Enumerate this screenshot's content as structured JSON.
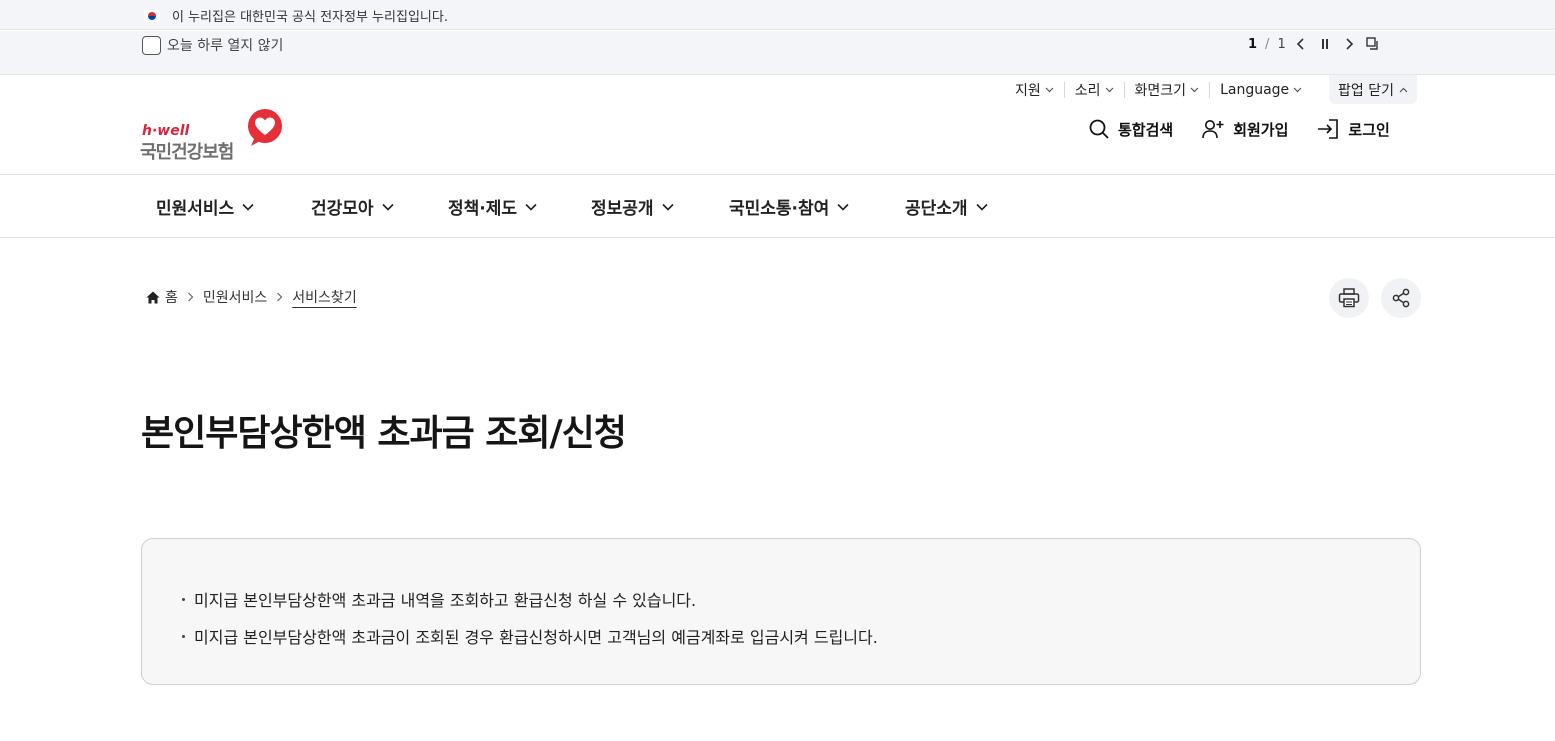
{
  "gov_banner": {
    "text": "이 누리집은 대한민국 공식 전자정부 누리집입니다."
  },
  "popup_zone": {
    "dismiss_label": "오늘 하루 열지 않기",
    "page_current": "1",
    "page_separator": "/",
    "page_total": "1"
  },
  "utility": {
    "items": [
      "지원",
      "소리",
      "화면크기",
      "Language"
    ],
    "popup_close": "팝업 닫기"
  },
  "logo": {
    "sub": "h·well",
    "main": "국민건강보험"
  },
  "header_actions": {
    "search": "통합검색",
    "signup": "회원가입",
    "login": "로그인"
  },
  "gnb": {
    "items": [
      "민원서비스",
      "건강모아",
      "정책·제도",
      "정보공개",
      "국민소통·참여",
      "공단소개"
    ]
  },
  "breadcrumb": {
    "home": "홈",
    "level1": "민원서비스",
    "current": "서비스찾기"
  },
  "page": {
    "title": "본인부담상한액 초과금 조회/신청",
    "info": [
      "미지급 본인부담상한액 초과금 내역을 조회하고 환급신청 하실 수 있습니다.",
      "미지급 본인부담상한액 초과금이 조회된 경우 환급신청하시면 고객님의 예금계좌로 입금시켜 드립니다."
    ]
  },
  "colors": {
    "brand_red": "#e5303a",
    "logo_gray": "#6f6f6f",
    "panel_bg": "#f4f5f9"
  }
}
